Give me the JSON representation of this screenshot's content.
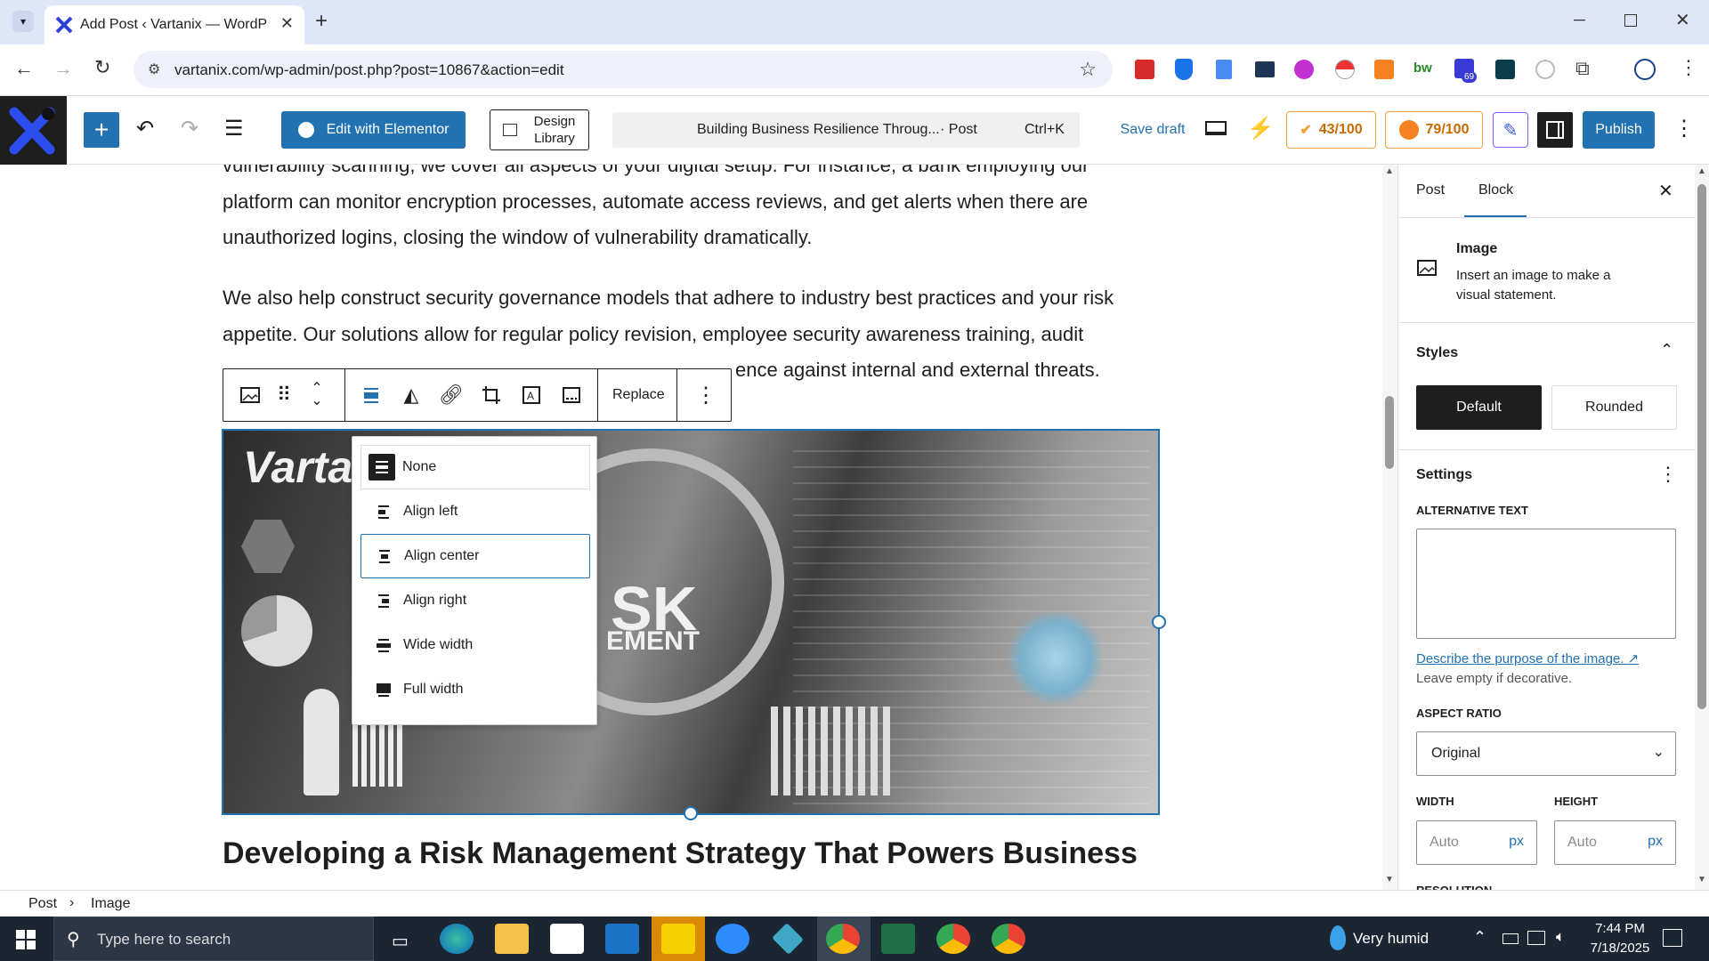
{
  "browser": {
    "tab_title": "Add Post ‹ Vartanix — WordPre",
    "url": "vartanix.com/wp-admin/post.php?post=10867&action=edit",
    "extension_badge": "69"
  },
  "toolbar": {
    "elementor_label": "Edit with Elementor",
    "design_library_label": "Design Library",
    "doc_title": "Building Business Resilience Throug...",
    "doc_type": "· Post",
    "shortcut": "Ctrl+K",
    "save_draft": "Save draft",
    "score_seo": "43/100",
    "score_readability": "79/100",
    "publish": "Publish"
  },
  "content": {
    "para1": "vulnerability scanning, we cover all aspects of your digital setup. For instance, a bank employing our platform can monitor encryption processes, automate access reviews, and get alerts when there are unauthorized logins, closing the window of vulnerability dramatically.",
    "para2_line1": "We also help construct security governance models that adhere to industry best practices and your risk",
    "para2_line2": "appetite. Our solutions allow for regular policy revision, employee security awareness training, audit",
    "para2_line3_tail": "ence against internal and external threats.",
    "heading": "Developing a Risk Management Strategy That Powers Business",
    "image_text_logo": "Varta",
    "image_text_sk": "SK",
    "image_text_ement": "EMENT",
    "replace_label": "Replace"
  },
  "align_menu": {
    "items": [
      {
        "label": "None"
      },
      {
        "label": "Align left"
      },
      {
        "label": "Align center"
      },
      {
        "label": "Align right"
      },
      {
        "label": "Wide width"
      },
      {
        "label": "Full width"
      }
    ]
  },
  "sidebar": {
    "tab_post": "Post",
    "tab_block": "Block",
    "block_title": "Image",
    "block_desc": "Insert an image to make a visual statement.",
    "styles_label": "Styles",
    "style_default": "Default",
    "style_rounded": "Rounded",
    "settings_label": "Settings",
    "alt_label": "ALTERNATIVE TEXT",
    "alt_link": "Describe the purpose of the image.",
    "alt_help": "Leave empty if decorative.",
    "aspect_label": "ASPECT RATIO",
    "aspect_value": "Original",
    "width_label": "WIDTH",
    "height_label": "HEIGHT",
    "width_placeholder": "Auto",
    "height_placeholder": "Auto",
    "unit": "px",
    "resolution_label": "RESOLUTION"
  },
  "breadcrumb": {
    "root": "Post",
    "current": "Image"
  },
  "taskbar": {
    "search_placeholder": "Type here to search",
    "weather": "Very humid",
    "time": "7:44 PM",
    "date": "7/18/2025"
  }
}
